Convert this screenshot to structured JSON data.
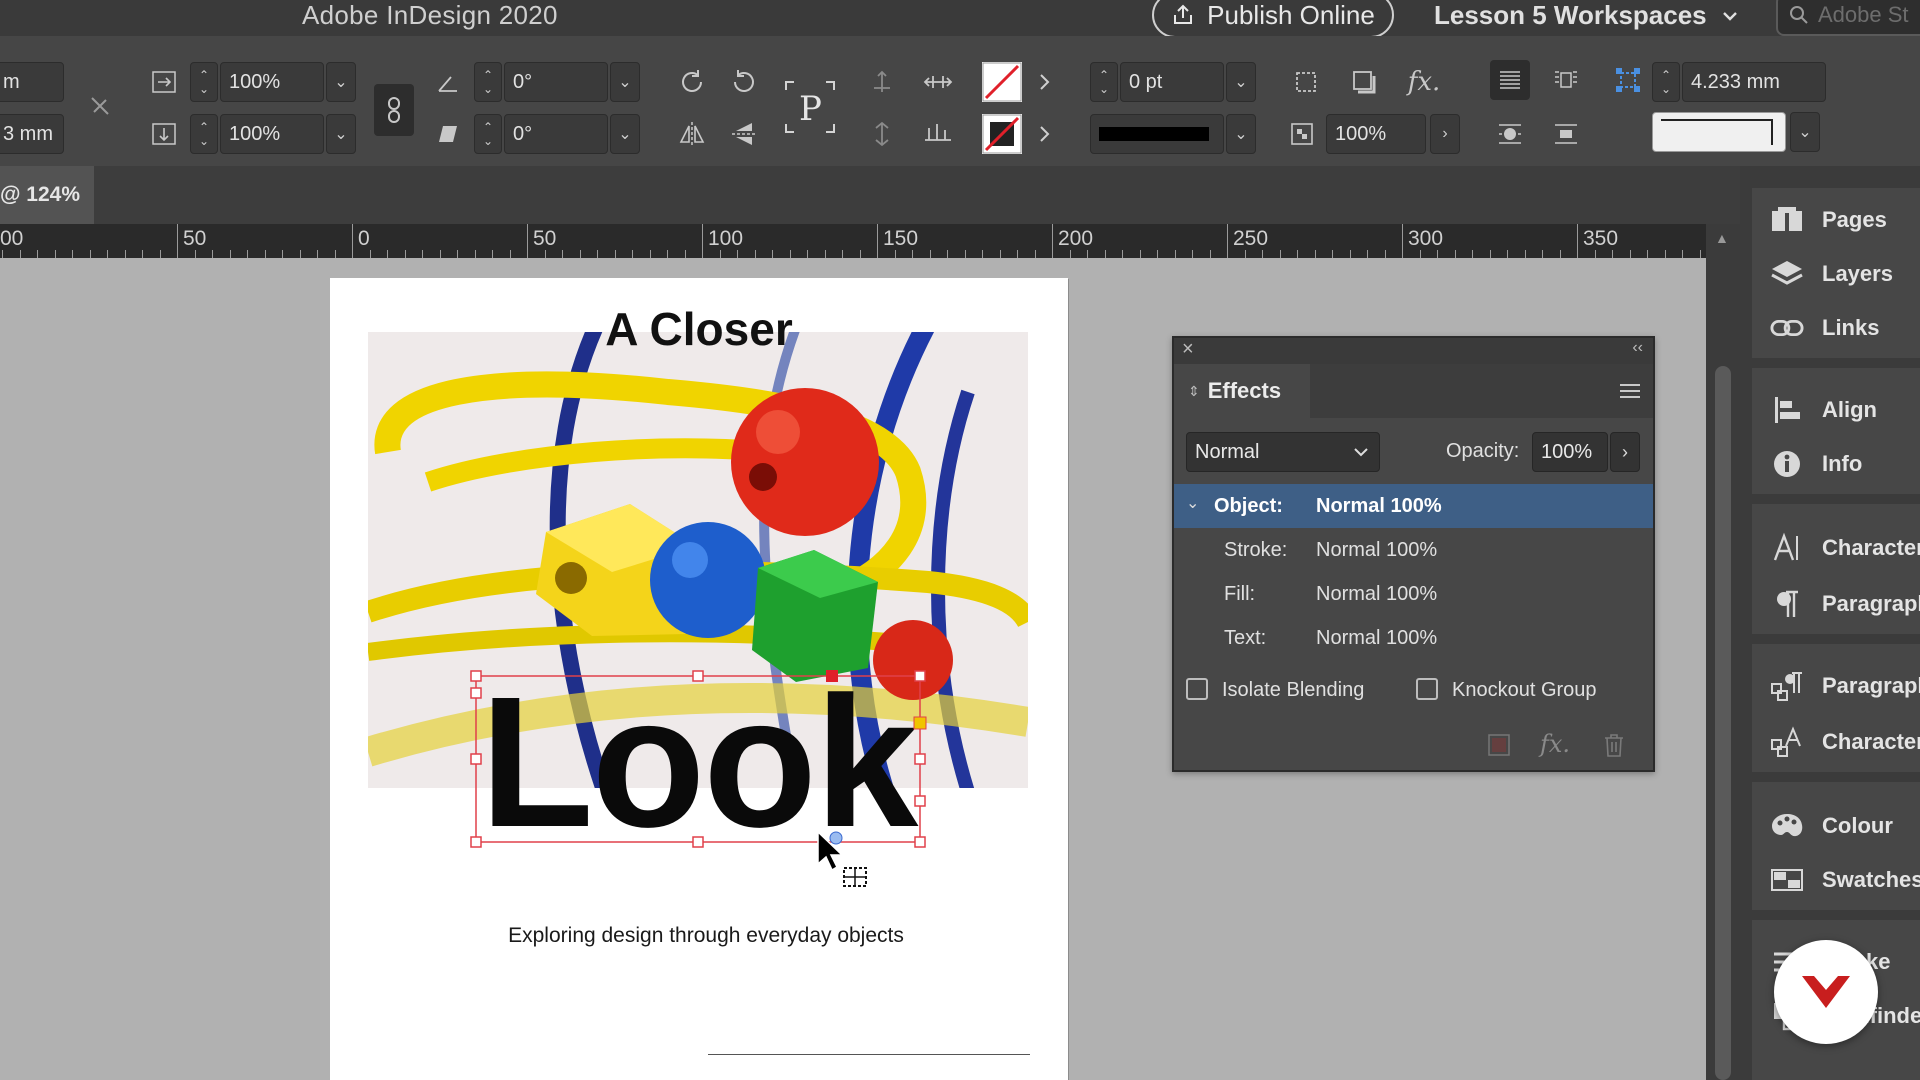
{
  "titlebar": {
    "app_title": "Adobe InDesign 2020",
    "publish_label": "Publish Online",
    "workspace_label": "Lesson 5 Workspaces",
    "search_placeholder": "Adobe St"
  },
  "controlbar": {
    "x_value": "m",
    "y_value": "3 mm",
    "scale_x": "100%",
    "scale_y": "100%",
    "rotate": "0°",
    "shear": "0°",
    "stroke_weight": "0 pt",
    "effect_opacity": "100%",
    "frame_offset": "4.233 mm"
  },
  "doc_tab": {
    "label": "@ 124%"
  },
  "ruler": {
    "labels": [
      "00",
      "50",
      "0",
      "50",
      "100",
      "150",
      "200",
      "250",
      "300",
      "350"
    ]
  },
  "page": {
    "headline": "A Closer",
    "big_word": "Look",
    "subtitle": "Exploring design through everyday objects"
  },
  "effects_panel": {
    "tab_label": "Effects",
    "blend_mode": "Normal",
    "opacity_label": "Opacity:",
    "opacity_value": "100%",
    "rows": [
      {
        "key": "Object:",
        "value": "Normal 100%"
      },
      {
        "key": "Stroke:",
        "value": "Normal 100%"
      },
      {
        "key": "Fill:",
        "value": "Normal 100%"
      },
      {
        "key": "Text:",
        "value": "Normal 100%"
      }
    ],
    "isolate_label": "Isolate Blending",
    "knockout_label": "Knockout Group"
  },
  "dock": {
    "items": [
      "Pages",
      "Layers",
      "Links",
      "Align",
      "Info",
      "Character",
      "Paragraph",
      "Paragraph Styles",
      "Character Styles",
      "Colour",
      "Swatches",
      "Stroke",
      "Pathfinder"
    ]
  },
  "colors": {
    "selection_row": "#3e5f86",
    "frame_selection": "#e0404a",
    "brand_badge": "#c81e1e"
  }
}
